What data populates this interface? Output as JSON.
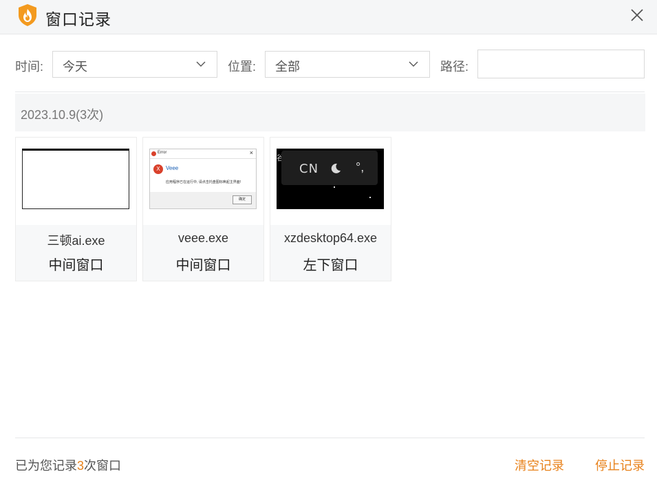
{
  "window": {
    "title": "窗口记录",
    "close_icon": "close-icon",
    "logo_icon": "shield-flame-logo"
  },
  "filters": {
    "time_label": "时间:",
    "time_value": "今天",
    "position_label": "位置:",
    "position_value": "全部",
    "path_label": "路径:",
    "path_value": "",
    "path_placeholder": ""
  },
  "group": {
    "date_header": "2023.10.9(3次)"
  },
  "records": [
    {
      "name": "三顿ai.exe",
      "position": "中间窗口"
    },
    {
      "name": "veee.exe",
      "position": "中间窗口",
      "thumb": {
        "title": "Error",
        "heading": "Veee",
        "message": "应用程序已在运行中, 请点击托盘图标唤起主界面!",
        "ok": "确定"
      }
    },
    {
      "name": "xzdesktop64.exe",
      "position": "左下窗口",
      "thumb": {
        "cn": "CN",
        "punct": "°,",
        "glyph": "谷"
      }
    }
  ],
  "footer": {
    "summary_prefix": "已为您记录",
    "summary_count": "3",
    "summary_suffix": "次窗口",
    "clear_label": "清空记录",
    "stop_label": "停止记录"
  },
  "colors": {
    "accent": "#e8821b",
    "logo": "#f39a1f"
  }
}
